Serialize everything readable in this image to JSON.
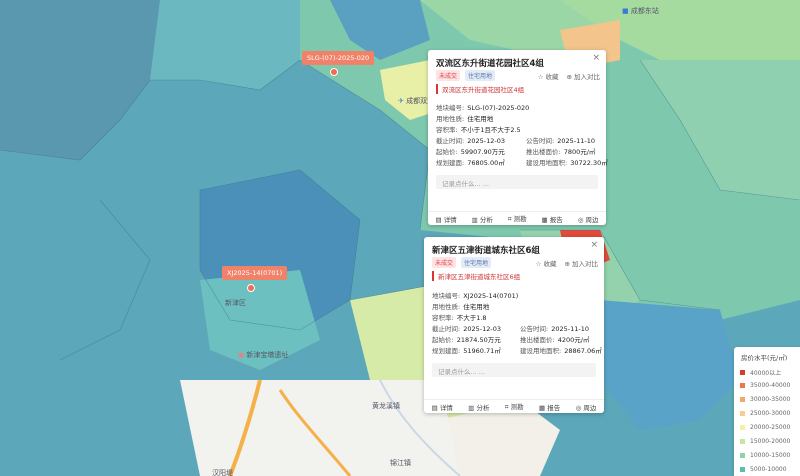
{
  "map": {
    "places": [
      {
        "name": "成都东站",
        "icon": "station-icon"
      },
      {
        "name": "成都双流"
      },
      {
        "name": "新津区"
      },
      {
        "name": "新津宝墩遗址"
      },
      {
        "name": "黄龙溪镇"
      },
      {
        "name": "锦江镇"
      },
      {
        "name": "汉阳堤"
      }
    ],
    "tag1": "SLG-(07)-2025-020",
    "tag2": "XJ2025-14(0701)"
  },
  "card1": {
    "title": "双流区东升街道花园社区4组",
    "close": "×",
    "badges": [
      "未成交",
      "住宅用地"
    ],
    "fav": "收藏",
    "compare": "加入对比",
    "subtitle": "双流区东升街道花园社区4组",
    "fields": {
      "parcel_no_label": "地块编号:",
      "parcel_no": "SLG-(07)-2025-020",
      "use_label": "用地性质:",
      "use": "住宅用地",
      "far_label": "容积率:",
      "far": "不小于1且不大于2.5",
      "end_label": "截止时间:",
      "end": "2025-12-03",
      "announce_label": "公告时间:",
      "announce": "2025-11-10",
      "start_price_label": "起始价:",
      "start_price": "59907.90万元",
      "floor_price_label": "推出楼面价:",
      "floor_price": "7800元/㎡",
      "plan_area_label": "规划建面:",
      "plan_area": "76805.00㎡",
      "land_area_label": "建设用地面积:",
      "land_area": "30722.30㎡"
    },
    "note_placeholder": "记录点什么... ...",
    "actions": [
      "详情",
      "分析",
      "测勘",
      "报告",
      "周边"
    ]
  },
  "card2": {
    "title": "新津区五津街道城东社区6组",
    "close": "×",
    "badges": [
      "未成交",
      "住宅用地"
    ],
    "fav": "收藏",
    "compare": "加入对比",
    "subtitle": "新津区五津街道城东社区6组",
    "fields": {
      "parcel_no_label": "地块编号:",
      "parcel_no": "XJ2025-14(0701)",
      "use_label": "用地性质:",
      "use": "住宅用地",
      "far_label": "容积率:",
      "far": "不大于1.8",
      "end_label": "截止时间:",
      "end": "2025-12-03",
      "announce_label": "公告时间:",
      "announce": "2025-11-10",
      "start_price_label": "起始价:",
      "start_price": "21874.50万元",
      "floor_price_label": "推出楼面价:",
      "floor_price": "4200元/㎡",
      "plan_area_label": "规划建面:",
      "plan_area": "51960.71㎡",
      "land_area_label": "建设用地面积:",
      "land_area": "28867.06㎡"
    },
    "note_placeholder": "记录点什么... ...",
    "actions": [
      "详情",
      "分析",
      "测勘",
      "报告",
      "周边"
    ]
  },
  "legend": {
    "title": "房价水平(元/㎡)",
    "items": [
      {
        "label": "40000以上",
        "color": "#d93a2b"
      },
      {
        "label": "35000-40000",
        "color": "#ee7748"
      },
      {
        "label": "30000-35000",
        "color": "#f5a66a"
      },
      {
        "label": "25000-30000",
        "color": "#f8cd8f"
      },
      {
        "label": "20000-25000",
        "color": "#f4f0a8"
      },
      {
        "label": "15000-20000",
        "color": "#c5e6a6"
      },
      {
        "label": "10000-15000",
        "color": "#8fd3a8"
      },
      {
        "label": "5000-10000",
        "color": "#5fbcb3"
      }
    ]
  }
}
